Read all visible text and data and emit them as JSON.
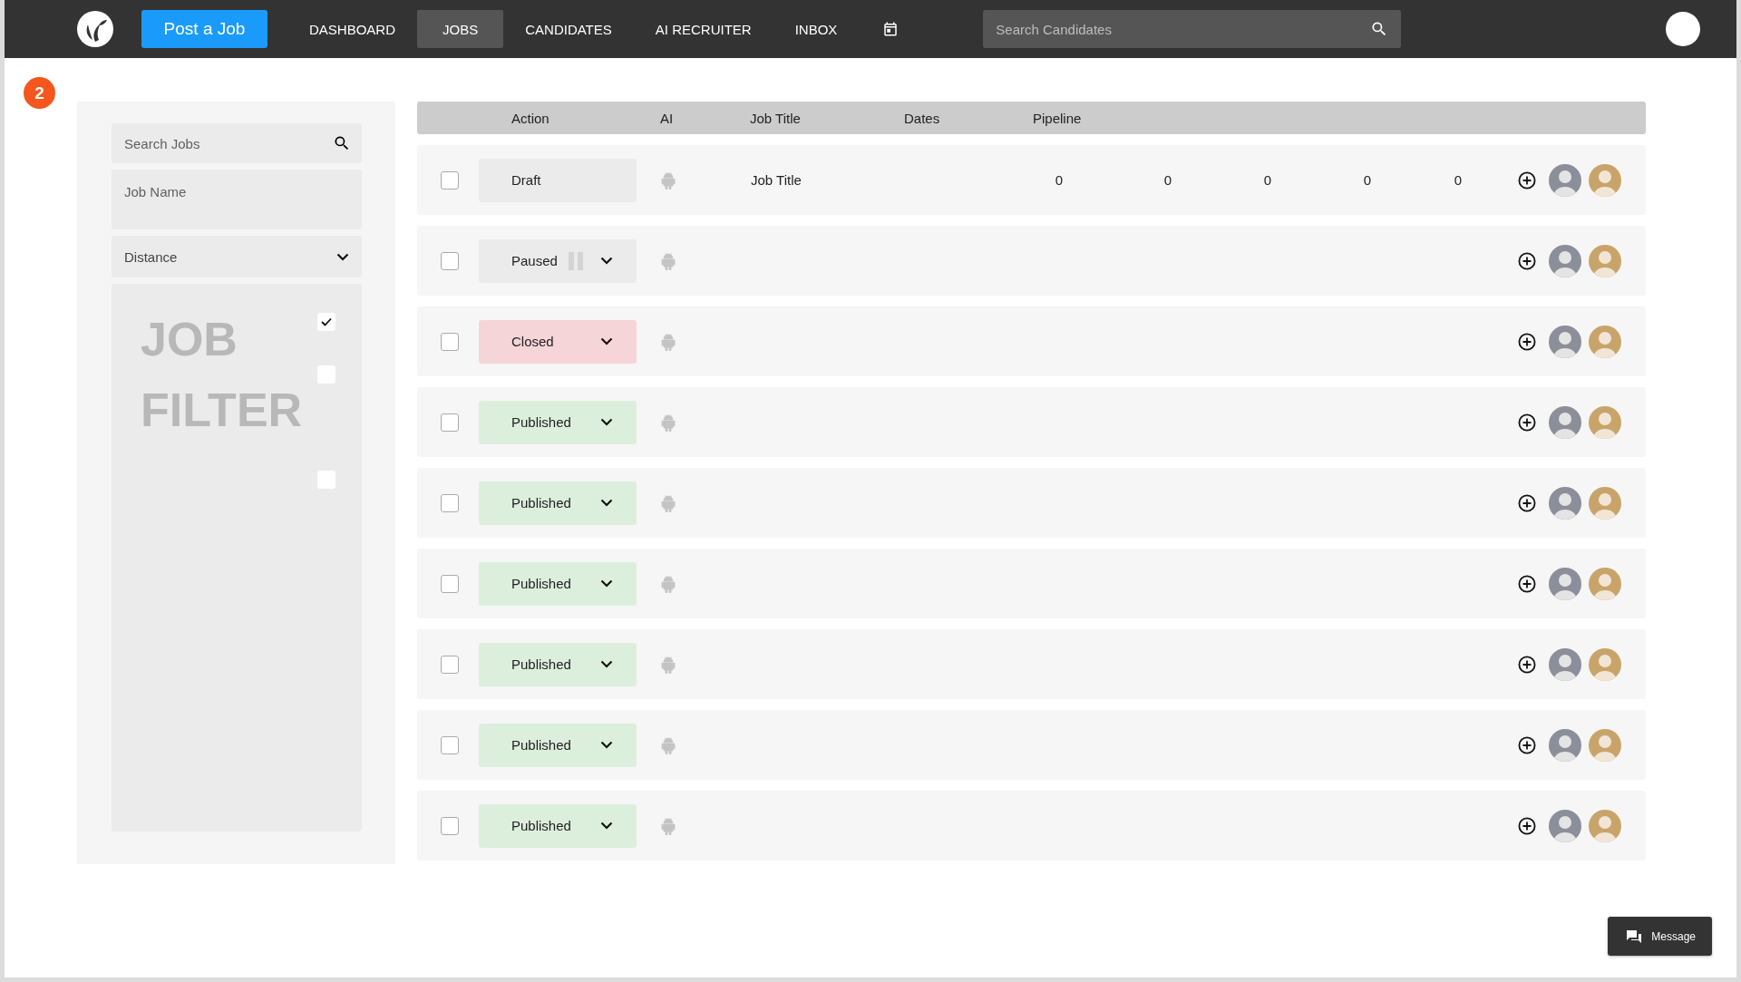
{
  "nav": {
    "post_job_button": "Post a Job",
    "tabs": [
      {
        "label": "DASHBOARD",
        "selected": false
      },
      {
        "label": "JOBS",
        "selected": true
      },
      {
        "label": "CANDIDATES",
        "selected": false
      },
      {
        "label": "AI RECRUITER",
        "selected": false
      },
      {
        "label": "INBOX",
        "selected": false
      }
    ],
    "search": {
      "placeholder": "Search Candidates"
    }
  },
  "step_badge": "2",
  "filters": {
    "search": {
      "placeholder": "Search Jobs"
    },
    "job_name": {
      "placeholder": "Job Name"
    },
    "distance": "Distance",
    "filter_box": {
      "watermark": "JOB FILTER",
      "checkboxes": [
        {
          "checked": true
        },
        {
          "checked": false
        },
        {
          "checked": false
        }
      ]
    }
  },
  "jobs": {
    "columns": [
      "Action",
      "AI",
      "Job Title",
      "Dates",
      "Pipeline"
    ],
    "rows": [
      {
        "checked": false,
        "status": {
          "kind": "draft",
          "label": "Draft"
        },
        "job_title": "Job Title",
        "pipeline": [
          "0",
          "0",
          "0",
          "0",
          "0"
        ]
      },
      {
        "checked": false,
        "status": {
          "kind": "paused",
          "label": "Paused"
        }
      },
      {
        "checked": false,
        "status": {
          "kind": "closed",
          "label": "Closed"
        }
      },
      {
        "checked": false,
        "status": {
          "kind": "published",
          "label": "Published"
        }
      },
      {
        "checked": false,
        "status": {
          "kind": "published",
          "label": "Published"
        }
      },
      {
        "checked": false,
        "status": {
          "kind": "published",
          "label": "Published"
        }
      },
      {
        "checked": false,
        "status": {
          "kind": "published",
          "label": "Published"
        }
      },
      {
        "checked": false,
        "status": {
          "kind": "published",
          "label": "Published"
        }
      },
      {
        "checked": false,
        "status": {
          "kind": "published",
          "label": "Published"
        }
      }
    ]
  },
  "message_button": "Message"
}
